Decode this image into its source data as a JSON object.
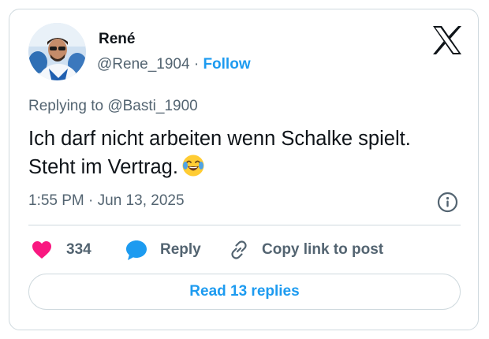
{
  "author": {
    "name": "René",
    "handle": "@Rene_1904",
    "separator": "·",
    "follow_label": "Follow"
  },
  "reply_context": {
    "prefix": "Replying to",
    "mention": "@Basti_1900"
  },
  "tweet": {
    "text": "Ich darf nicht arbeiten wenn Schalke spielt. Steht im Vertrag.",
    "emoji": "face-with-tears-of-joy",
    "timestamp": "1:55 PM · Jun 13, 2025"
  },
  "actions": {
    "like_count": "334",
    "reply_label": "Reply",
    "copy_label": "Copy link to post"
  },
  "read_replies_label": "Read 13 replies",
  "colors": {
    "like": "#f91880",
    "link": "#1d9bf0",
    "secondary_text": "#536471",
    "border": "#cfd9de"
  },
  "icons": [
    "x-logo-icon",
    "info-icon",
    "heart-icon",
    "reply-bubble-icon",
    "link-icon",
    "laughing-emoji-icon"
  ]
}
